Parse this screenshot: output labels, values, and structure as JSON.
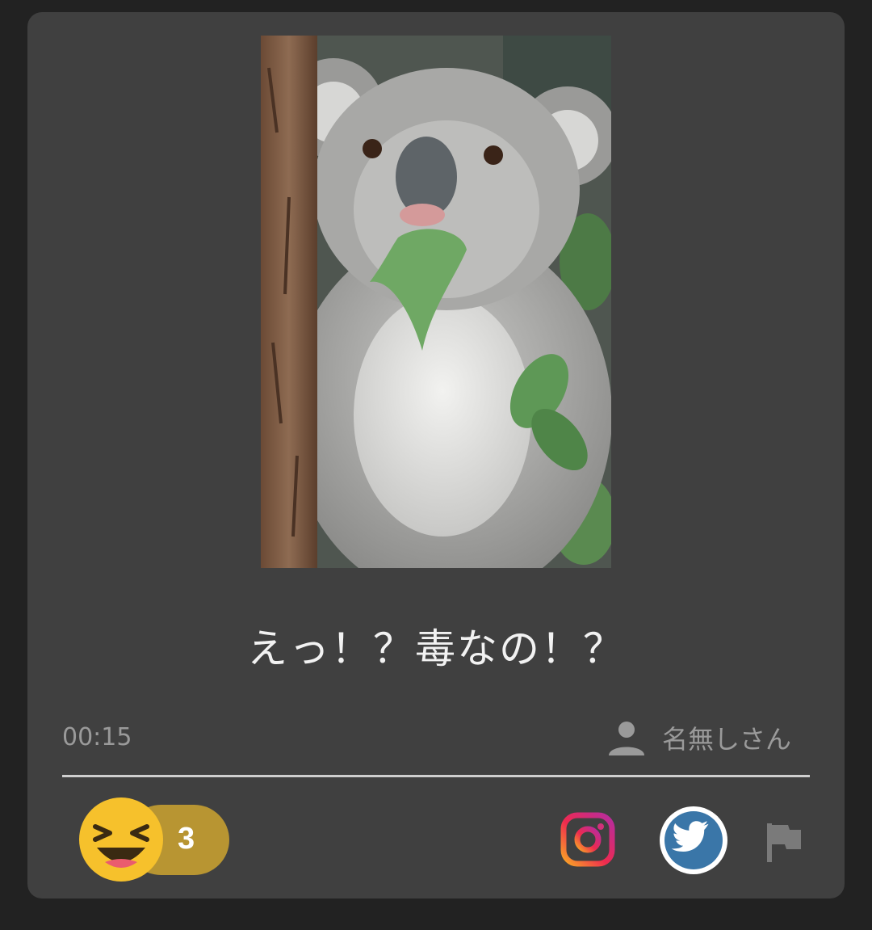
{
  "post": {
    "caption": "えっ！？毒なの！？",
    "time": "00:15",
    "author": "名無しさん"
  },
  "image": {
    "subject": "startled koala holding eucalyptus leaf in mouth"
  },
  "reactions": {
    "emoji": "laughing-face",
    "count": "3"
  },
  "icons": {
    "author": "person-icon",
    "instagram": "instagram-icon",
    "twitter": "twitter-icon",
    "report": "flag-icon"
  },
  "colors": {
    "card_background": "#404040",
    "page_background": "#222222",
    "reaction_pill": "#b89532",
    "emoji_yellow": "#f6c12c",
    "twitter_blue": "#3a76a8"
  }
}
